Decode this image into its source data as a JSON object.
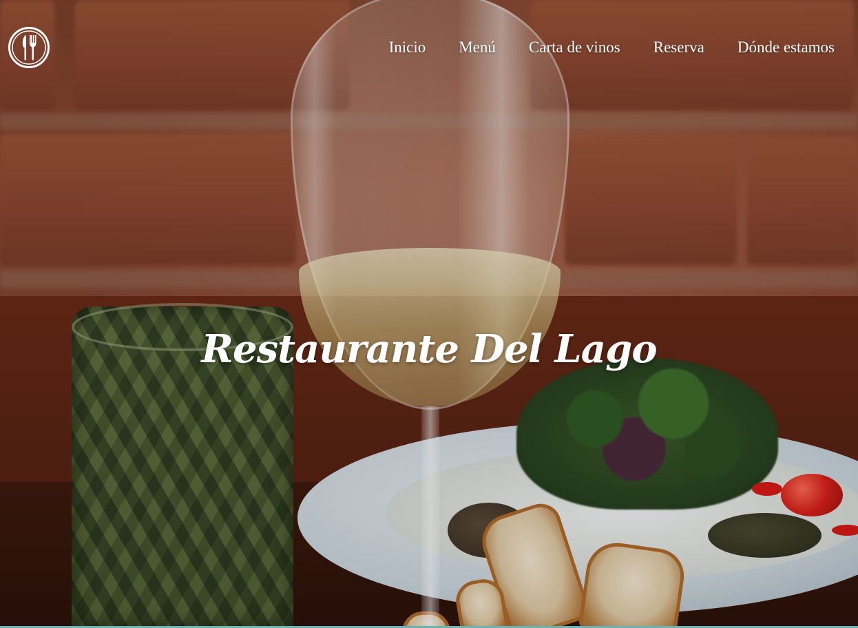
{
  "site": {
    "title": "Restaurante Del Lago"
  },
  "logo": {
    "icon": "fork-and-knife-icon"
  },
  "nav": {
    "items": [
      {
        "label": "Inicio"
      },
      {
        "label": "Menú"
      },
      {
        "label": "Carta de vinos"
      },
      {
        "label": "Reserva"
      },
      {
        "label": "Dónde estamos"
      }
    ]
  },
  "colors": {
    "nav_text": "#ffffff",
    "title_text": "#ffffff",
    "accent_line": "#6fb0b0"
  }
}
